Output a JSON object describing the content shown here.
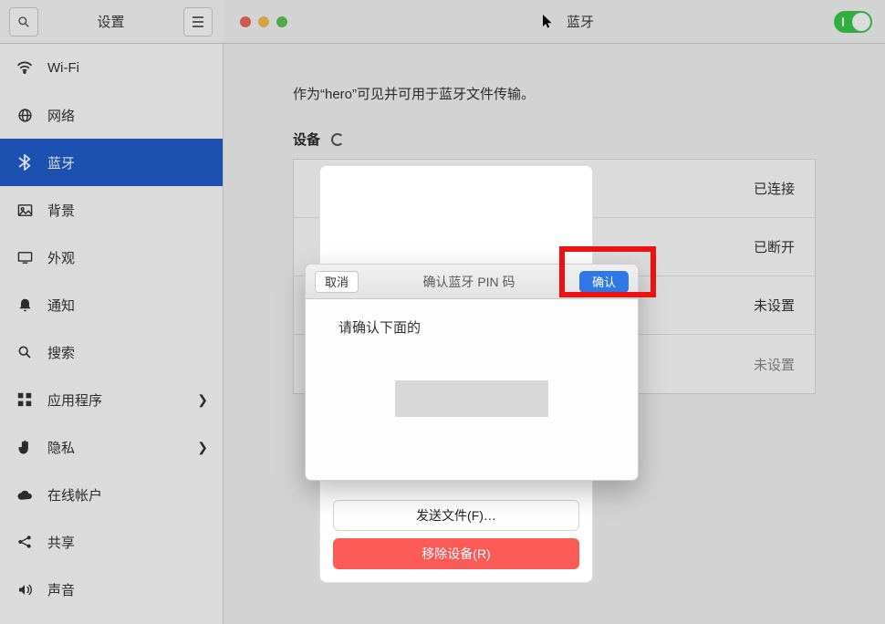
{
  "header": {
    "left_title": "设置",
    "right_title": "蓝牙"
  },
  "sidebar": {
    "items": [
      {
        "key": "wifi",
        "label": "Wi-Fi"
      },
      {
        "key": "network",
        "label": "网络"
      },
      {
        "key": "bt",
        "label": "蓝牙"
      },
      {
        "key": "bg",
        "label": "背景"
      },
      {
        "key": "appear",
        "label": "外观"
      },
      {
        "key": "notif",
        "label": "通知"
      },
      {
        "key": "search",
        "label": "搜索"
      },
      {
        "key": "apps",
        "label": "应用程序"
      },
      {
        "key": "privacy",
        "label": "隐私"
      },
      {
        "key": "online",
        "label": "在线帐户"
      },
      {
        "key": "share",
        "label": "共享"
      },
      {
        "key": "sound",
        "label": "声音"
      }
    ]
  },
  "main": {
    "visible_text": "作为“hero”可见并可用于蓝牙文件传输。",
    "devices_heading": "设备",
    "devices": [
      {
        "status": "已连接"
      },
      {
        "status": "已断开"
      },
      {
        "status": "未设置"
      },
      {
        "status": "未设置"
      }
    ],
    "detail": {
      "send_file": "发送文件(F)…",
      "remove_device": "移除设备(R)"
    }
  },
  "modal": {
    "title": "确认蓝牙 PIN 码",
    "cancel": "取消",
    "confirm": "确认",
    "message": "请确认下面的"
  }
}
